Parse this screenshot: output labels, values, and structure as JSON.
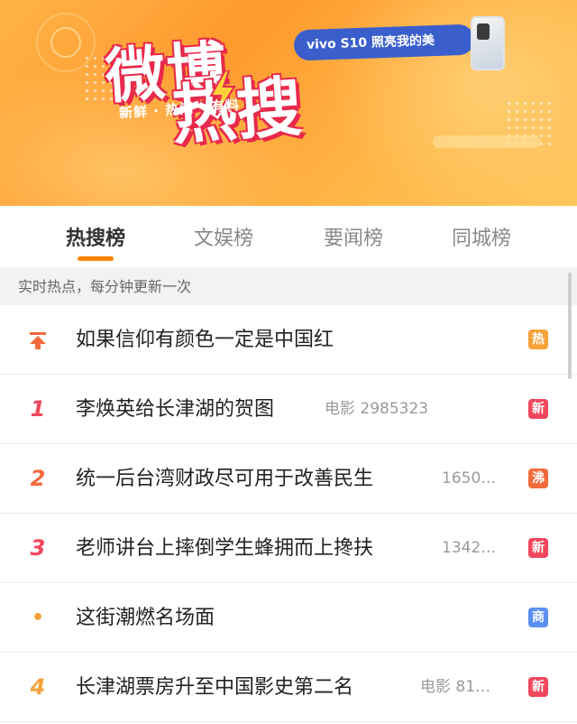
{
  "banner": {
    "logo_line1": "微博",
    "logo_line2": "热搜",
    "slogan": "新鲜 · 热门 · 有料",
    "ad_text": "vivo S10 照亮我的美",
    "brand_color": "#ff8200"
  },
  "tabs": [
    {
      "label": "热搜榜",
      "active": true
    },
    {
      "label": "文娱榜",
      "active": false
    },
    {
      "label": "要闻榜",
      "active": false
    },
    {
      "label": "同城榜",
      "active": false
    }
  ],
  "info_text": "实时热点，每分钟更新一次",
  "rows": [
    {
      "rank": "",
      "rank_icon": "pinned-top-icon",
      "title": "如果信仰有颜色一定是中国红",
      "meta": "",
      "badge": "热",
      "badge_color": "#f6a23a"
    },
    {
      "rank": "1",
      "title": "李焕英给长津湖的贺图",
      "meta": "电影 2985323",
      "badge": "新",
      "badge_color": "#f0475c"
    },
    {
      "rank": "2",
      "title": "统一后台湾财政尽可用于改善民生",
      "meta": "1650…",
      "badge": "沸",
      "badge_color": "#f26b3a"
    },
    {
      "rank": "3",
      "title": "老师讲台上摔倒学生蜂拥而上搀扶",
      "meta": "1342…",
      "badge": "新",
      "badge_color": "#f0475c"
    },
    {
      "rank": "•",
      "title": "这街潮燃名场面",
      "meta": "",
      "badge": "商",
      "badge_color": "#5b8ff0"
    },
    {
      "rank": "4",
      "title": "长津湖票房升至中国影史第二名",
      "meta": "电影 81…",
      "badge": "新",
      "badge_color": "#f0475c"
    }
  ]
}
